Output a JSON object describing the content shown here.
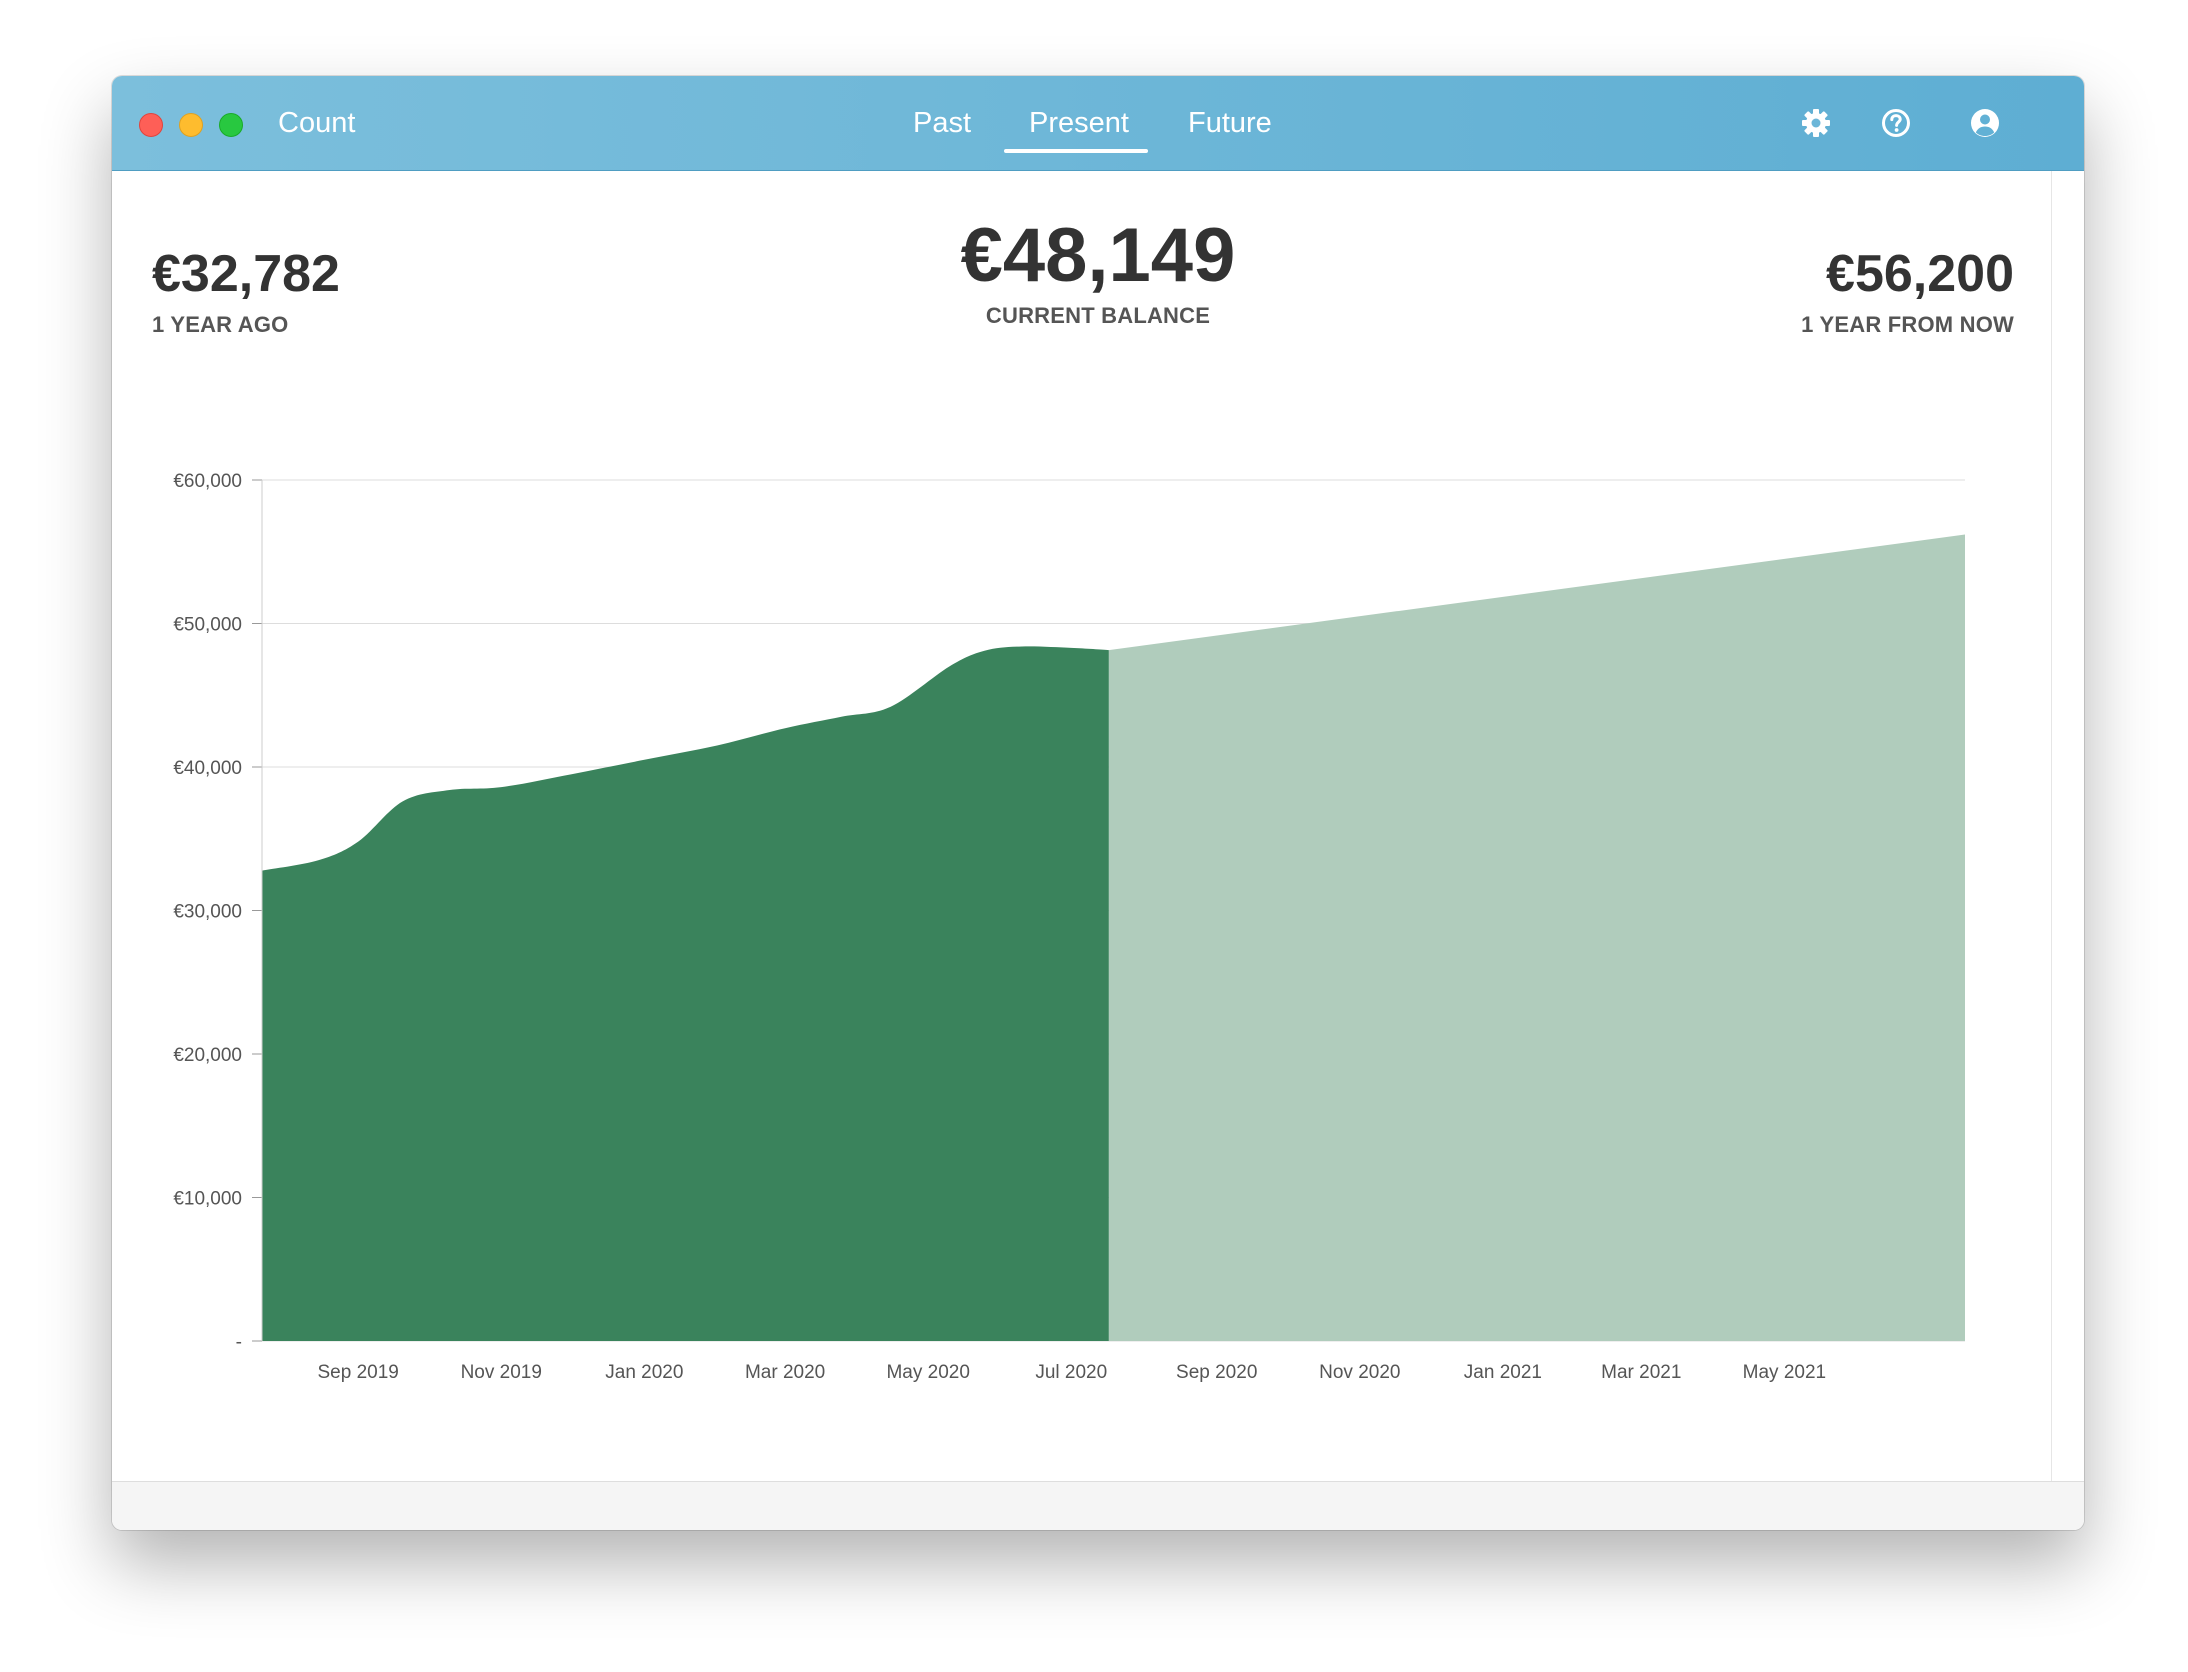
{
  "window": {
    "app_title": "Count"
  },
  "tabs": [
    {
      "label": "Past",
      "active": false
    },
    {
      "label": "Present",
      "active": true
    },
    {
      "label": "Future",
      "active": false
    }
  ],
  "toolbar": {
    "icons": [
      "gear-icon",
      "help-icon",
      "user-icon"
    ]
  },
  "summary": {
    "past_value": "€32,782",
    "past_label": "1 YEAR AGO",
    "current_value": "€48,149",
    "current_label": "CURRENT BALANCE",
    "future_value": "€56,200",
    "future_label": "1 YEAR FROM NOW"
  },
  "colors": {
    "titlebar": "#6cb6d8",
    "past_area": "#3a835c",
    "future_area": "#b0ccbc",
    "text": "#333333"
  },
  "chart_data": {
    "type": "area",
    "title": "",
    "xlabel": "",
    "ylabel": "",
    "ylim": [
      0,
      60000
    ],
    "y_ticks": [
      "€60,000",
      "€50,000",
      "€40,000",
      "€30,000",
      "€20,000",
      "€10,000",
      "-"
    ],
    "x_ticks": [
      "Sep 2019",
      "Nov 2019",
      "Jan 2020",
      "Mar 2020",
      "May 2020",
      "Jul 2020",
      "Sep 2020",
      "Nov 2020",
      "Jan 2021",
      "Mar 2021",
      "May 2021"
    ],
    "grid": true,
    "series": [
      {
        "x": [
          "2019-07-22",
          "2019-08-15",
          "2019-09-01",
          "2019-09-20",
          "2019-10-10",
          "2019-11-01",
          "2019-12-01",
          "2020-01-01",
          "2020-02-01",
          "2020-03-01",
          "2020-03-25",
          "2020-04-15",
          "2020-05-10",
          "2020-05-25",
          "2020-06-10",
          "2020-07-01",
          "2020-07-17"
        ],
        "y": [
          32782,
          33500,
          34800,
          37600,
          38400,
          38600,
          39500,
          40500,
          41500,
          42700,
          43500,
          44200,
          47000,
          48100,
          48400,
          48300,
          48149
        ]
      },
      {
        "x": [
          "2020-07-17",
          "2021-07-17"
        ],
        "y": [
          48149,
          56200
        ]
      }
    ]
  }
}
